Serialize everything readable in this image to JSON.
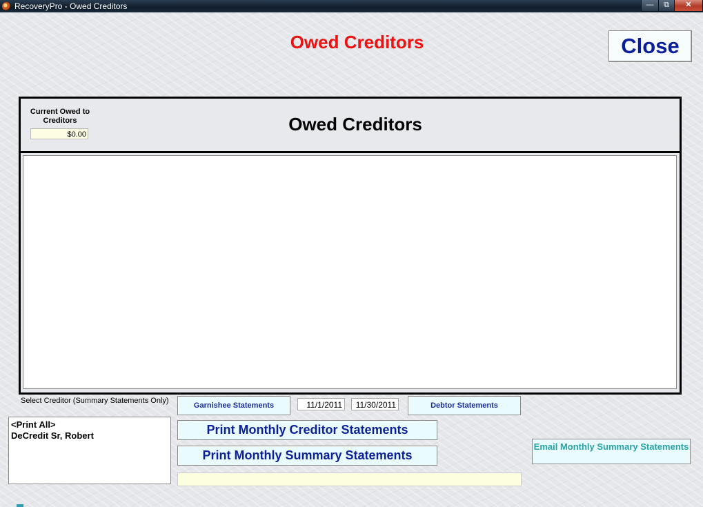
{
  "window": {
    "title": "RecoveryPro - Owed Creditors",
    "min_label": "—",
    "max_label": "⧉",
    "close_label": "✕"
  },
  "header": {
    "title": "Owed Creditors",
    "close_label": "Close"
  },
  "panel": {
    "owed_label": "Current Owed to Creditors",
    "owed_value": "$0.00",
    "title": "Owed Creditors"
  },
  "creditor_select": {
    "label": "Select Creditor (Summary Statements Only)",
    "items": [
      "<Print All>",
      "DeCredit Sr, Robert"
    ]
  },
  "buttons": {
    "garnishee": "Garnishee Statements",
    "debtor": "Debtor Statements",
    "print_creditor": "Print Monthly Creditor Statements",
    "print_summary": "Print Monthly Summary Statements",
    "email_summary": "Email Monthly Summary Statements"
  },
  "dates": {
    "start": "11/1/2011",
    "end": "11/30/2011"
  },
  "colors": {
    "title_red": "#ee1111",
    "button_blue": "#0b1f9a",
    "button_bg": "#e9fbfc",
    "email_teal": "#27a3a6"
  }
}
